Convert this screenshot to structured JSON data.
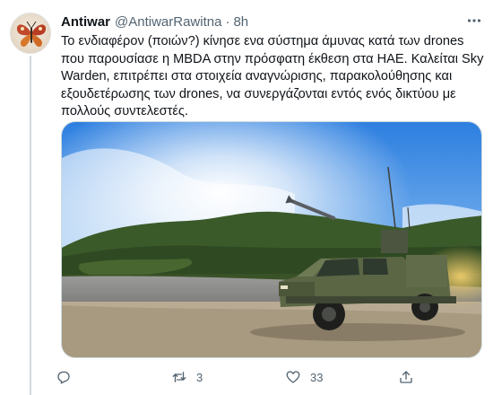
{
  "tweet": {
    "author_name": "Antiwar",
    "author_handle": "@AntiwarRawitna",
    "separator": "·",
    "time": "8h",
    "text": "Το ενδιαφέρον (ποιών?) κίνησε ενα σύστημα άμυνας κατά των drones που παρουσίασε η MBDA στην πρόσφατη έκθεση στα ΗΑΕ. Καλείται Sky Warden, επιτρέπει στα στοιχεία αναγνώρισης, παρακολούθησης και εξουδετέρωσης των drones, να συνεργάζονται εντός ενός δικτύου με πολλούς συντελεστές.",
    "media_icon": "photo-military-vehicle-with-drone",
    "actions": {
      "reply_icon": "reply-icon",
      "retweet_icon": "retweet-icon",
      "retweet_count": "3",
      "like_icon": "heart-icon",
      "like_count": "33",
      "share_icon": "share-icon"
    }
  },
  "colors": {
    "text": "#0f1419",
    "secondary": "#536471",
    "border": "#cfd9de"
  }
}
